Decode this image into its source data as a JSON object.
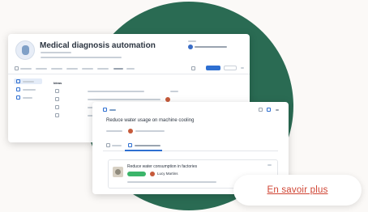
{
  "colors": {
    "background": "#fbf9f7",
    "circle": "#2a6b53",
    "accent": "#2e6fd1",
    "cta_text": "#d04534",
    "status_green": "#3bb56a"
  },
  "back_window": {
    "title": "Medical diagnosis automation",
    "table_header": "Ideas"
  },
  "front_card": {
    "title": "Reduce water usage on machine cooling",
    "linked_card": {
      "title": "Reduce water consumption in factories",
      "owner": "Lucy Martins"
    }
  },
  "cta": {
    "label": "En savoir plus"
  }
}
